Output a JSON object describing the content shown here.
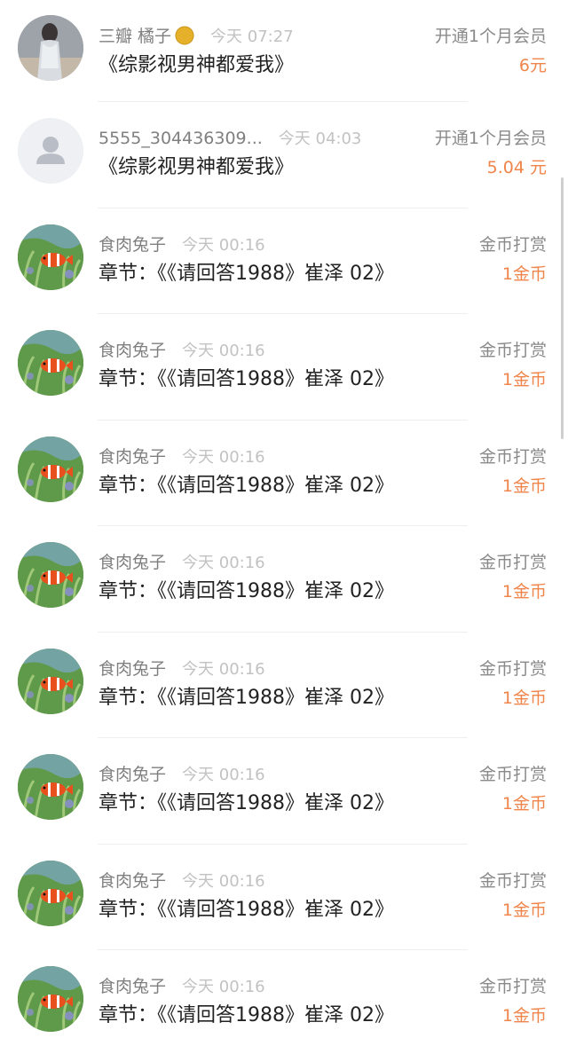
{
  "items": [
    {
      "avatar": "user-photo",
      "user": "三瓣 橘子",
      "vip_icon": "moon-badge-icon",
      "time": "今天 07:27",
      "content": "《综影视男神都爱我》",
      "type": "开通1个月会员",
      "amount": "6元"
    },
    {
      "avatar": "default-user-icon",
      "user": "5555_304436309...",
      "time": "今天 04:03",
      "content": "《综影视男神都爱我》",
      "type": "开通1个月会员",
      "amount": "5.04 元"
    },
    {
      "avatar": "clownfish-photo",
      "user": "食肉兔子",
      "time": "今天 00:16",
      "content": "章节：《《请回答1988》崔泽 02》",
      "type": "金币打赏",
      "amount": "1金币"
    },
    {
      "avatar": "clownfish-photo",
      "user": "食肉兔子",
      "time": "今天 00:16",
      "content": "章节：《《请回答1988》崔泽 02》",
      "type": "金币打赏",
      "amount": "1金币"
    },
    {
      "avatar": "clownfish-photo",
      "user": "食肉兔子",
      "time": "今天 00:16",
      "content": "章节：《《请回答1988》崔泽 02》",
      "type": "金币打赏",
      "amount": "1金币"
    },
    {
      "avatar": "clownfish-photo",
      "user": "食肉兔子",
      "time": "今天 00:16",
      "content": "章节：《《请回答1988》崔泽 02》",
      "type": "金币打赏",
      "amount": "1金币"
    },
    {
      "avatar": "clownfish-photo",
      "user": "食肉兔子",
      "time": "今天 00:16",
      "content": "章节：《《请回答1988》崔泽 02》",
      "type": "金币打赏",
      "amount": "1金币"
    },
    {
      "avatar": "clownfish-photo",
      "user": "食肉兔子",
      "time": "今天 00:16",
      "content": "章节：《《请回答1988》崔泽 02》",
      "type": "金币打赏",
      "amount": "1金币"
    },
    {
      "avatar": "clownfish-photo",
      "user": "食肉兔子",
      "time": "今天 00:16",
      "content": "章节：《《请回答1988》崔泽 02》",
      "type": "金币打赏",
      "amount": "1金币"
    },
    {
      "avatar": "clownfish-photo",
      "user": "食肉兔子",
      "time": "今天 00:16",
      "content": "章节：《《请回答1988》崔泽 02》",
      "type": "金币打赏",
      "amount": "1金币"
    }
  ],
  "colors": {
    "amount": "#f0854b",
    "meta": "#8a8a8a",
    "time": "#c2c2c2",
    "content": "#222222",
    "separator": "#eeeeee"
  }
}
